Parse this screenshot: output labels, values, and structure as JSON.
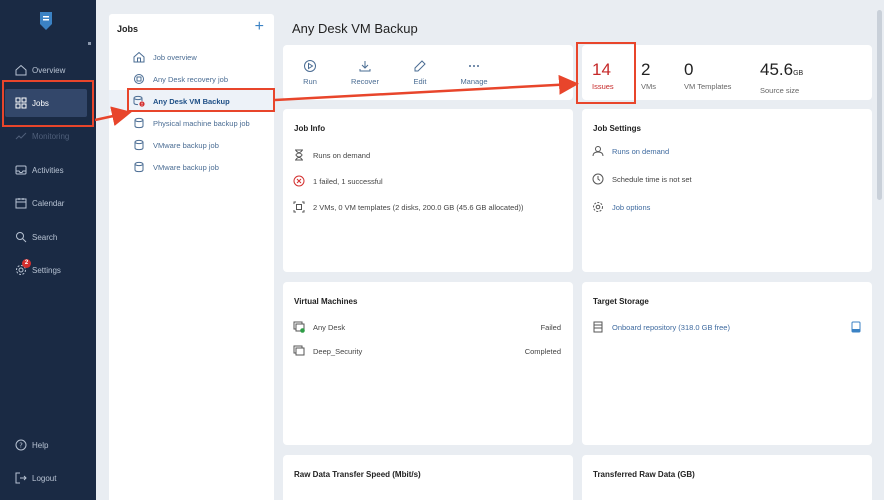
{
  "sidebar": {
    "items": [
      {
        "label": "Overview",
        "icon": "home-icon"
      },
      {
        "label": "Jobs",
        "icon": "grid-icon"
      },
      {
        "label": "Monitoring",
        "icon": "monitoring-icon"
      },
      {
        "label": "Activities",
        "icon": "inbox-icon"
      },
      {
        "label": "Calendar",
        "icon": "calendar-icon"
      },
      {
        "label": "Search",
        "icon": "search-icon"
      },
      {
        "label": "Settings",
        "icon": "gear-icon",
        "badge": "2"
      }
    ],
    "help": "Help",
    "logout": "Logout"
  },
  "jobs": {
    "header": "Jobs",
    "add": "+",
    "items": [
      {
        "label": "Job overview"
      },
      {
        "label": "Any Desk recovery job"
      },
      {
        "label": "Any Desk VM Backup"
      },
      {
        "label": "Physical machine backup job"
      },
      {
        "label": "VMware backup job"
      },
      {
        "label": "VMware backup job"
      }
    ]
  },
  "main": {
    "title": "Any Desk VM Backup",
    "toolbar": {
      "run": "Run",
      "recover": "Recover",
      "edit": "Edit",
      "manage": "Manage"
    },
    "stats": {
      "issues": {
        "value": "14",
        "label": "Issues"
      },
      "vms": {
        "value": "2",
        "label": "VMs"
      },
      "templates": {
        "value": "0",
        "label": "VM Templates"
      },
      "size": {
        "value": "45.6",
        "unit": "GB",
        "label": "Source size"
      }
    },
    "job_info": {
      "title": "Job Info",
      "schedule": "Runs on demand",
      "result": "1 failed, 1 successful",
      "scope": "2 VMs, 0 VM templates (2 disks, 200.0 GB (45.6 GB allocated))"
    },
    "job_settings": {
      "title": "Job Settings",
      "runs": "Runs on demand",
      "schedule": "Schedule time is not set",
      "options": "Job options"
    },
    "virtual_machines": {
      "title": "Virtual Machines",
      "rows": [
        {
          "name": "Any Desk",
          "status": "Failed"
        },
        {
          "name": "Deep_Security",
          "status": "Completed"
        }
      ]
    },
    "target_storage": {
      "title": "Target Storage",
      "repo": "Onboard repository (318.0 GB free)"
    },
    "raw_speed": {
      "title": "Raw Data Transfer Speed (Mbit/s)"
    },
    "raw_data": {
      "title": "Transferred Raw Data (GB)"
    }
  },
  "colors": {
    "sidebar": "#1a2a44",
    "accent": "#3b82c4",
    "annotation": "#e8452b",
    "error": "#c62828"
  }
}
